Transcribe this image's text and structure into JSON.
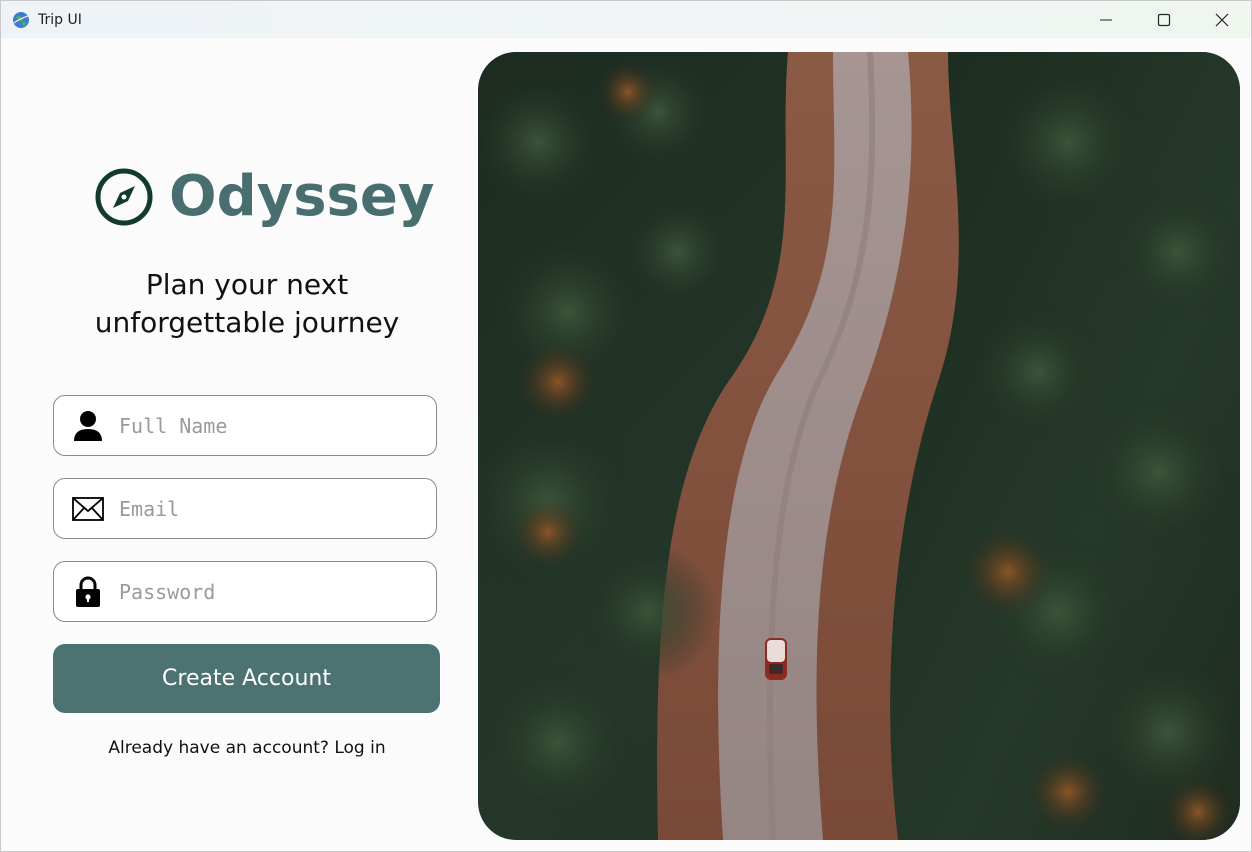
{
  "window": {
    "title": "Trip UI",
    "icon": "globe-icon",
    "controls": [
      "minimize-icon",
      "maximize-icon",
      "close-icon"
    ]
  },
  "brand": {
    "name": "Odyssey",
    "icon": "compass-icon",
    "color": "#496e70"
  },
  "tagline": {
    "line1": "Plan your next",
    "line2": "unforgettable journey"
  },
  "form": {
    "full_name": {
      "placeholder": "Full Name",
      "value": "",
      "icon": "person-icon"
    },
    "email": {
      "placeholder": "Email",
      "value": "",
      "icon": "envelope-icon"
    },
    "password": {
      "placeholder": "Password",
      "value": "",
      "icon": "lock-icon"
    },
    "submit_label": "Create Account",
    "submit_color": "#4d7272"
  },
  "login": {
    "prompt": "Already have an account?",
    "link": "Log in"
  },
  "hero": {
    "description_icon": "forest-road-photo"
  }
}
